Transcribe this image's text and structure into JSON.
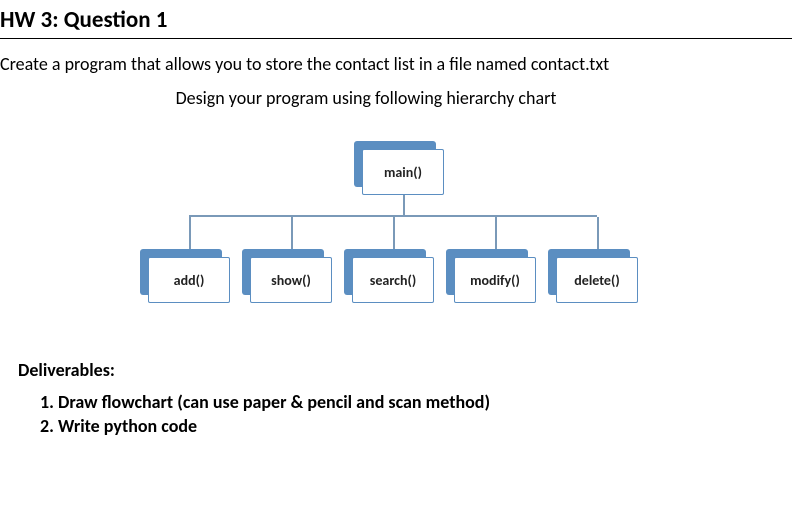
{
  "heading": "HW 3: Question 1",
  "instruction_1": "Create a program that allows you to store the contact list in a file named contact.txt",
  "instruction_2": "Design your program using following hierarchy chart",
  "chart_data": {
    "type": "hierarchy",
    "root": "main()",
    "children": [
      "add()",
      "show()",
      "search()",
      "modify()",
      "delete()"
    ]
  },
  "deliverables_heading": "Deliverables:",
  "deliverables": {
    "item1": "Draw flowchart (can use paper & pencil and scan method)",
    "item2": "Write python code"
  }
}
